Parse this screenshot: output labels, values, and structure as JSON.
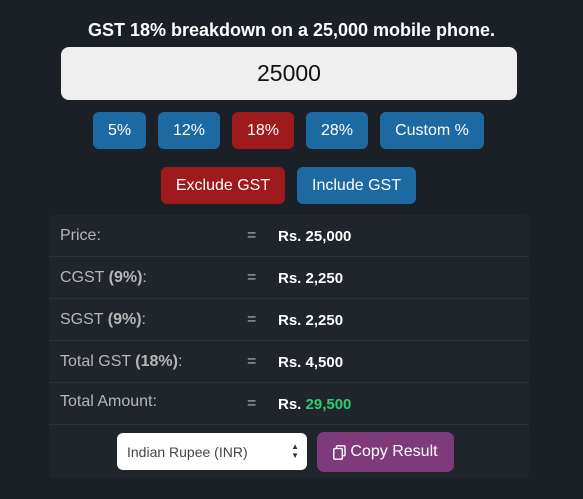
{
  "title": "GST 18% breakdown on a 25,000 mobile phone.",
  "amount_input": {
    "value": "25000"
  },
  "rate_buttons": [
    {
      "label": "5%",
      "active": false
    },
    {
      "label": "12%",
      "active": false
    },
    {
      "label": "18%",
      "active": true
    },
    {
      "label": "28%",
      "active": false
    },
    {
      "label": "Custom %",
      "active": false
    }
  ],
  "mode_buttons": {
    "exclude_label": "Exclude GST",
    "include_label": "Include GST",
    "active": "exclude"
  },
  "results": {
    "price": {
      "label": "Price:",
      "eq": "=",
      "currency": "Rs.",
      "value": "25,000"
    },
    "cgst": {
      "label": "CGST",
      "rate": "(9%)",
      "colon": ":",
      "eq": "=",
      "currency": "Rs.",
      "value": "2,250"
    },
    "sgst": {
      "label": "SGST",
      "rate": "(9%)",
      "colon": ":",
      "eq": "=",
      "currency": "Rs.",
      "value": "2,250"
    },
    "total_gst": {
      "label": "Total GST",
      "rate": "(18%)",
      "colon": ":",
      "eq": "=",
      "currency": "Rs.",
      "value": "4,500"
    },
    "total_amount": {
      "label": "Total Amount:",
      "eq": "=",
      "currency": "Rs.",
      "value": "29,500"
    }
  },
  "currency_select": {
    "selected": "Indian Rupee (INR)"
  },
  "copy_button": {
    "label": "Copy Result",
    "icon": "copy-icon"
  },
  "colors": {
    "background": "#1b2027",
    "blue_button": "#1c6aa1",
    "active_red": "#9e1a1c",
    "copy_purple": "#7f3a7c",
    "total_green": "#2ecc71"
  }
}
